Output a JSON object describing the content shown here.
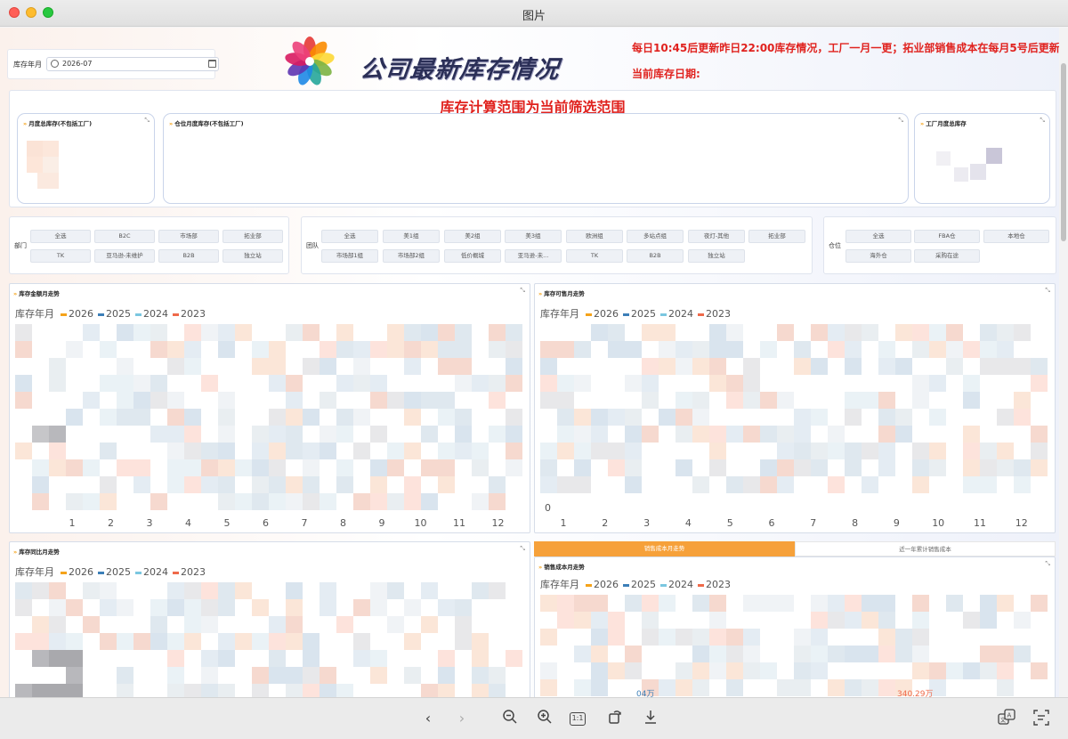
{
  "window": {
    "title": "图片"
  },
  "filters": {
    "month_label": "库存年月",
    "month_value": "2026-07"
  },
  "header": {
    "title": "公司最新库存情况",
    "notice": "每日10:45后更新昨日22:00库存情况，工厂一月一更；拓业部销售成本在每月5号后更新",
    "stock_date_label": "当前库存日期:"
  },
  "range": {
    "title": "库存计算范围为当前筛选范围",
    "cards": [
      {
        "title": "月度总库存(不包括工厂)"
      },
      {
        "title": "仓位月度库存(不包括工厂)"
      },
      {
        "title": "工厂月度总库存"
      }
    ]
  },
  "department": {
    "label": "部门",
    "options": [
      "全选",
      "B2C",
      "市场部",
      "拓业部",
      "TK",
      "亚马逊-未维护",
      "B2B",
      "独立站"
    ]
  },
  "team": {
    "label": "团队",
    "options": [
      "全选",
      "美1组",
      "美2组",
      "美3组",
      "欧洲组",
      "多站点组",
      "夜灯-其他",
      "拓业部",
      "市场部1组",
      "市场部2组",
      "低价概城",
      "亚马逊-未...",
      "TK",
      "B2B",
      "独立站"
    ]
  },
  "warehouse": {
    "label": "仓位",
    "options": [
      "全选",
      "FBA仓",
      "本地仓",
      "海外仓",
      "采购在途"
    ]
  },
  "panels": [
    {
      "title": "库存金额月走势",
      "legend_title": "库存年月"
    },
    {
      "title": "库存可售月走势",
      "legend_title": "库存年月",
      "y_zero": "0"
    },
    {
      "title": "库存同比月走势",
      "legend_title": "库存年月"
    },
    {
      "title": "销售成本月走势",
      "legend_title": "库存年月"
    }
  ],
  "sales_tabs": {
    "active": "销售成本月走势",
    "inactive": "近一年累计销售成本"
  },
  "colors": {
    "accent_red": "#e0221e",
    "tab_orange": "#f6a13a",
    "series": [
      "#f5a31a",
      "#3c7fb8",
      "#7bc7e0",
      "#ef6a4a"
    ]
  },
  "toolbar": {
    "icons": [
      "back-icon",
      "forward-icon",
      "zoom-out-icon",
      "zoom-in-icon",
      "actual-size-icon",
      "rotate-icon",
      "download-icon",
      "translate-icon",
      "text-recognition-icon"
    ],
    "actual_size_label": "1:1"
  },
  "chart_data": [
    {
      "type": "line",
      "title": "库存金额月走势",
      "categories": [
        "1",
        "2",
        "3",
        "4",
        "5",
        "6",
        "7",
        "8",
        "9",
        "10",
        "11",
        "12"
      ],
      "series": [
        {
          "name": "2026"
        },
        {
          "name": "2025"
        },
        {
          "name": "2024"
        },
        {
          "name": "2023"
        }
      ],
      "note_values_obscured": true
    },
    {
      "type": "line",
      "title": "库存可售月走势",
      "categories": [
        "1",
        "2",
        "3",
        "4",
        "5",
        "6",
        "7",
        "8",
        "9",
        "10",
        "11",
        "12"
      ],
      "series": [
        {
          "name": "2026"
        },
        {
          "name": "2025"
        },
        {
          "name": "2024"
        },
        {
          "name": "2023"
        }
      ],
      "y_min": 0
    },
    {
      "type": "line",
      "title": "库存同比月走势",
      "series": [
        {
          "name": "2026"
        },
        {
          "name": "2025"
        },
        {
          "name": "2024"
        },
        {
          "name": "2023"
        }
      ]
    },
    {
      "type": "line",
      "title": "销售成本月走势",
      "series": [
        {
          "name": "2026"
        },
        {
          "name": "2025"
        },
        {
          "name": "2024"
        },
        {
          "name": "2023"
        }
      ],
      "visible_labels": [
        "04万",
        "340.29万"
      ]
    }
  ]
}
